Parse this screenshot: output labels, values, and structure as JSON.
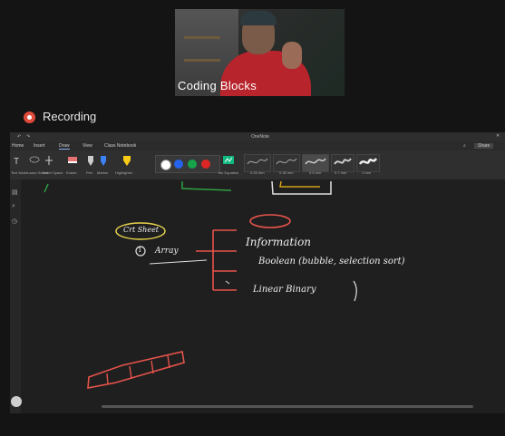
{
  "video": {
    "participant_name": "Coding Blocks"
  },
  "recording": {
    "label": "Recording"
  },
  "onenote": {
    "title": "OneNote",
    "tabs": [
      "Home",
      "Insert",
      "Draw",
      "View",
      "Class Notebook"
    ],
    "share_label": "Share",
    "tools": {
      "select_label": "Text Mode",
      "lasso_label": "Lasso Select",
      "space_label": "Insert Space",
      "eraser_label": "Eraser",
      "pen_label": "Pen",
      "marker_label": "Marker",
      "highlighter_label": "Highlighter",
      "ink_label": "Ink Equation"
    },
    "pen_presets": [
      "0.25 mm",
      "0.35 mm",
      "0.5 mm",
      "0.7 mm",
      "1 mm"
    ],
    "colors": [
      "#ffffff",
      "#2563eb",
      "#16a34a",
      "#dc2626"
    ]
  },
  "notes": {
    "chip_label": "Crt Sheet",
    "array_label": "Array",
    "bullet_index": "1",
    "line1": "Information",
    "line2": "Boolean (bubble, selection sort)",
    "line3": "Linear Binary"
  }
}
